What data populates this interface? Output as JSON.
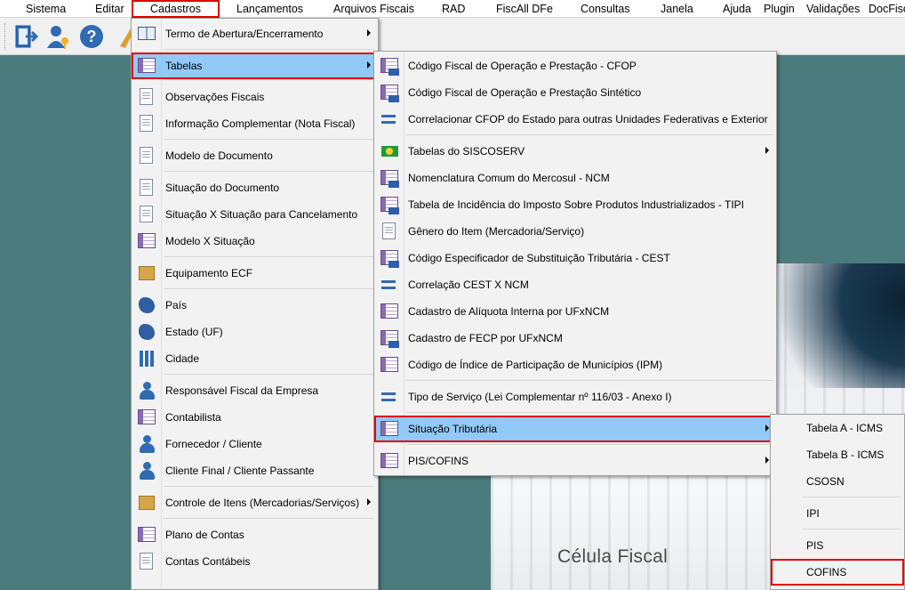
{
  "menubar": {
    "items": [
      "Sistema",
      "Editar",
      "Cadastros",
      "Lançamentos",
      "Arquivos Fiscais",
      "RAD",
      "FiscAll DFe",
      "Consultas",
      "Janela",
      "Ajuda",
      "Plugin",
      "Validações",
      "DocFisc"
    ]
  },
  "toolbar": {
    "buttons": [
      "exit-icon",
      "user-key-icon",
      "help-icon",
      "tools-icon"
    ]
  },
  "background": {
    "brand_text": "Célula Fiscal"
  },
  "cadastros_menu": {
    "items": [
      {
        "label": "Termo de Abertura/Encerramento",
        "icon": "book-icon",
        "submenu": true
      },
      {
        "label": "Tabelas",
        "icon": "table-icon",
        "submenu": true,
        "highlighted": true
      },
      {
        "label": "Observações Fiscais",
        "icon": "binoculars-doc-icon"
      },
      {
        "label": "Informação Complementar (Nota Fiscal)",
        "icon": "doc-add-icon"
      },
      {
        "label": "Modelo de Documento",
        "icon": "document-icon"
      },
      {
        "label": "Situação do Documento",
        "icon": "doc-info-icon"
      },
      {
        "label": "Situação X Situação para Cancelamento",
        "icon": "doc-warning-icon"
      },
      {
        "label": "Modelo X Situação",
        "icon": "doc-grid-icon"
      },
      {
        "label": "Equipamento ECF",
        "icon": "printer-icon"
      },
      {
        "label": "País",
        "icon": "country-map-icon"
      },
      {
        "label": "Estado (UF)",
        "icon": "state-map-icon"
      },
      {
        "label": "Cidade",
        "icon": "city-icon"
      },
      {
        "label": "Responsável Fiscal da Empresa",
        "icon": "person-icon"
      },
      {
        "label": "Contabilista",
        "icon": "spreadsheet-icon"
      },
      {
        "label": "Fornecedor / Cliente",
        "icon": "people-icon"
      },
      {
        "label": "Cliente Final / Cliente Passante",
        "icon": "person-icon"
      },
      {
        "label": "Controle de Itens (Mercadorias/Serviços)",
        "icon": "box-clock-icon",
        "submenu": true
      },
      {
        "label": "Plano de Contas",
        "icon": "ledger-icon"
      },
      {
        "label": "Contas Contábeis",
        "icon": "account-icon"
      }
    ]
  },
  "tabelas_menu": {
    "items": [
      {
        "label": "Código Fiscal de Operação e Prestação - CFOP",
        "icon": "cfop-icon"
      },
      {
        "label": "Código Fiscal de Operação e Prestação Sintético",
        "icon": "cfop-summary-icon"
      },
      {
        "label": "Correlacionar CFOP do Estado para outras Unidades Federativas e Exterior",
        "icon": "correlate-icon"
      },
      {
        "label": "Tabelas do SISCOSERV",
        "icon": "brazil-flag-icon",
        "submenu": true
      },
      {
        "label": "Nomenclatura Comum do Mercosul - NCM",
        "icon": "ncm-icon"
      },
      {
        "label": "Tabela de Incidência do Imposto Sobre Produtos Industrializados - TIPI",
        "icon": "tipi-icon"
      },
      {
        "label": "Gênero do Item (Mercadoria/Serviço)",
        "icon": "genre-icon"
      },
      {
        "label": "Código Especificador de Substituição Tributária - CEST",
        "icon": "cest-icon"
      },
      {
        "label": "Correlação CEST X NCM",
        "icon": "correlate-icon"
      },
      {
        "label": "Cadastro de Alíquota Interna por UFxNCM",
        "icon": "rate-icon"
      },
      {
        "label": "Cadastro de FECP por UFxNCM",
        "icon": "fecp-icon"
      },
      {
        "label": "Código de Índice de Participação de Municípios (IPM)",
        "icon": "ipm-icon"
      },
      {
        "label": "Tipo de Serviço (Lei Complementar nº 116/03 - Anexo I)",
        "icon": "service-icon"
      },
      {
        "label": "Situação Tributária",
        "icon": "tax-status-icon",
        "submenu": true,
        "highlighted": true
      },
      {
        "label": "PIS/COFINS",
        "icon": "pis-cofins-icon",
        "submenu": true
      }
    ]
  },
  "situacao_menu": {
    "items": [
      "Tabela A - ICMS",
      "Tabela B - ICMS",
      "CSOSN",
      "IPI",
      "PIS",
      "COFINS"
    ]
  }
}
